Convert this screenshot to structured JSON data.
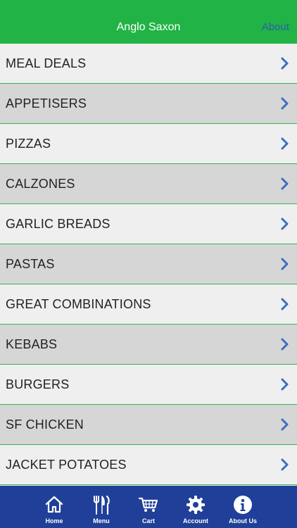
{
  "header": {
    "title": "Anglo Saxon",
    "about_label": "About"
  },
  "menu": {
    "items": [
      {
        "label": "MEAL DEALS"
      },
      {
        "label": "APPETISERS"
      },
      {
        "label": "PIZZAS"
      },
      {
        "label": "CALZONES"
      },
      {
        "label": "GARLIC BREADS"
      },
      {
        "label": "PASTAS"
      },
      {
        "label": "GREAT COMBINATIONS"
      },
      {
        "label": "KEBABS"
      },
      {
        "label": "BURGERS"
      },
      {
        "label": "SF CHICKEN"
      },
      {
        "label": "JACKET POTATOES"
      }
    ]
  },
  "tabs": [
    {
      "label": "Home",
      "icon": "home-icon"
    },
    {
      "label": "Menu",
      "icon": "cutlery-icon"
    },
    {
      "label": "Cart",
      "icon": "cart-icon"
    },
    {
      "label": "Account",
      "icon": "gear-icon"
    },
    {
      "label": "About Us",
      "icon": "info-icon"
    }
  ],
  "colors": {
    "header_bg": "#21b345",
    "link": "#2a5fb4",
    "row_light": "#efefef",
    "row_dark": "#d6d6d6",
    "separator": "#35b54f",
    "chevron": "#3d6cc0",
    "tabbar_bg": "#1f3f99"
  }
}
